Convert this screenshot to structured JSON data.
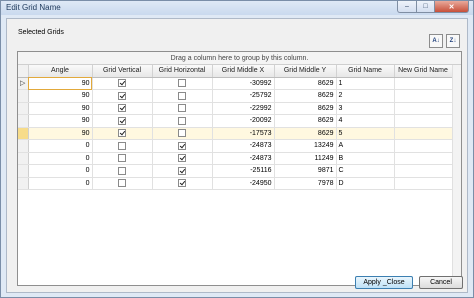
{
  "window": {
    "title": "Edit Grid Name",
    "controls": {
      "minimize": "–",
      "maximize": "□",
      "close": "✕"
    }
  },
  "section_label": "Selected Grids",
  "toolbar": {
    "sort_ascending_icon": "sort-ascending-icon",
    "sort_ascending_glyph": "A↓",
    "sort_descending_icon": "sort-descending-icon",
    "sort_descending_glyph": "Z↓"
  },
  "grid": {
    "group_panel_text": "Drag a column here to group by this column.",
    "columns": [
      "Angle",
      "Grid Vertical",
      "Grid Horizontal",
      "Grid Middle X",
      "Grid Middle Y",
      "Grid Name",
      "New Grid Name"
    ],
    "current_row_indicator": "▷",
    "rows": [
      {
        "angle": "90",
        "vertical": true,
        "horizontal": false,
        "mid_x": "-30992",
        "mid_y": "8629",
        "name": "1",
        "new_name": "",
        "current": true,
        "selected": false
      },
      {
        "angle": "90",
        "vertical": true,
        "horizontal": false,
        "mid_x": "-25792",
        "mid_y": "8629",
        "name": "2",
        "new_name": "",
        "current": false,
        "selected": false
      },
      {
        "angle": "90",
        "vertical": true,
        "horizontal": false,
        "mid_x": "-22992",
        "mid_y": "8629",
        "name": "3",
        "new_name": "",
        "current": false,
        "selected": false
      },
      {
        "angle": "90",
        "vertical": true,
        "horizontal": false,
        "mid_x": "-20092",
        "mid_y": "8629",
        "name": "4",
        "new_name": "",
        "current": false,
        "selected": false
      },
      {
        "angle": "90",
        "vertical": true,
        "horizontal": false,
        "mid_x": "-17573",
        "mid_y": "8629",
        "name": "5",
        "new_name": "",
        "current": false,
        "selected": true
      },
      {
        "angle": "0",
        "vertical": false,
        "horizontal": true,
        "mid_x": "-24873",
        "mid_y": "13249",
        "name": "A",
        "new_name": "",
        "current": false,
        "selected": false
      },
      {
        "angle": "0",
        "vertical": false,
        "horizontal": true,
        "mid_x": "-24873",
        "mid_y": "11249",
        "name": "B",
        "new_name": "",
        "current": false,
        "selected": false
      },
      {
        "angle": "0",
        "vertical": false,
        "horizontal": true,
        "mid_x": "-25116",
        "mid_y": "9871",
        "name": "C",
        "new_name": "",
        "current": false,
        "selected": false
      },
      {
        "angle": "0",
        "vertical": false,
        "horizontal": true,
        "mid_x": "-24950",
        "mid_y": "7978",
        "name": "D",
        "new_name": "",
        "current": false,
        "selected": false
      }
    ]
  },
  "buttons": {
    "apply_close": "Apply _Close",
    "cancel": "Cancel"
  },
  "colors": {
    "selected_row": "#fff8e0",
    "selected_indicator": "#f7dc8a",
    "active_cell_border": "#e2a93b"
  }
}
